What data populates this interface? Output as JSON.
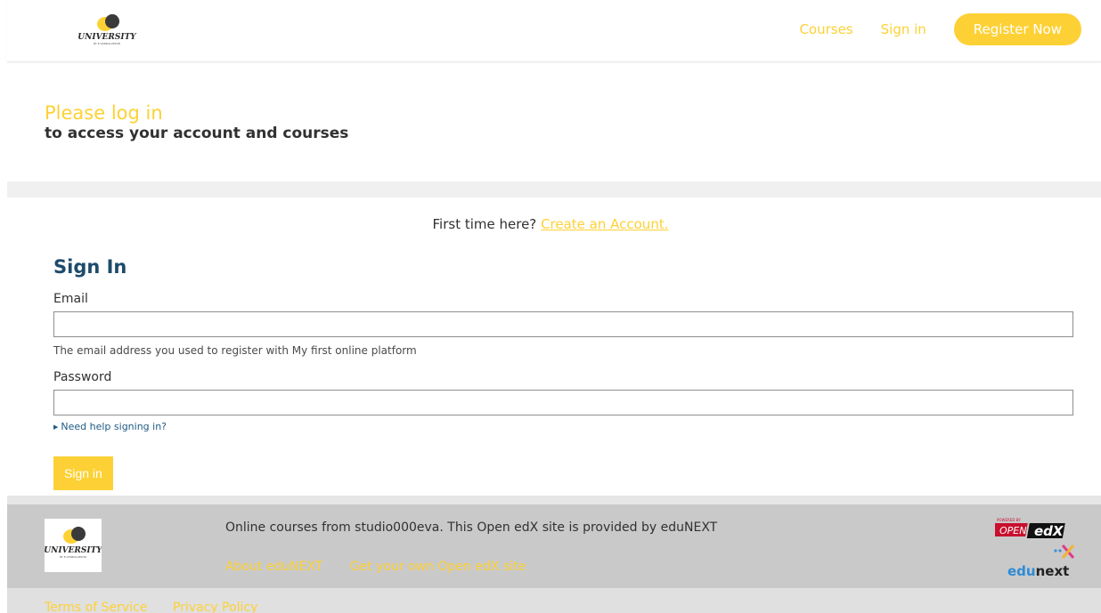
{
  "colors": {
    "accent": "#fdd135",
    "title_blue": "#1e4b6b",
    "link_blue": "#1e5a84",
    "footer_bg": "#c9c9c9"
  },
  "header": {
    "logo_text": "UNIVERSITY",
    "logo_subtext": "BY E.VANDALLESON",
    "nav": {
      "courses": "Courses",
      "sign_in": "Sign in",
      "register": "Register Now"
    }
  },
  "hero": {
    "title": "Please log in",
    "subtitle": "to access your account and courses"
  },
  "notice": {
    "text": "First time here?",
    "link": "Create an Account."
  },
  "form": {
    "title": "Sign In",
    "email_label": "Email",
    "email_value": "",
    "email_hint": "The email address you used to register with My first online platform",
    "password_label": "Password",
    "password_value": "",
    "help_link": "Need help signing in?",
    "submit_label": "Sign in"
  },
  "footer": {
    "logo_text": "UNIVERSITY",
    "logo_subtext": "BY E.VANDALLESON",
    "text": "Online courses from studio000eva. This Open edX site is provided by eduNEXT",
    "links": [
      "About eduNEXT",
      "Get your own Open edX site"
    ],
    "openedx_badge": {
      "powered_by": "POWERED BY",
      "open": "OPEN",
      "edx": "edX"
    },
    "edunext_logo": {
      "edu": "edu",
      "next": "next"
    },
    "legal": [
      "Terms of Service",
      "Privacy Policy"
    ]
  }
}
